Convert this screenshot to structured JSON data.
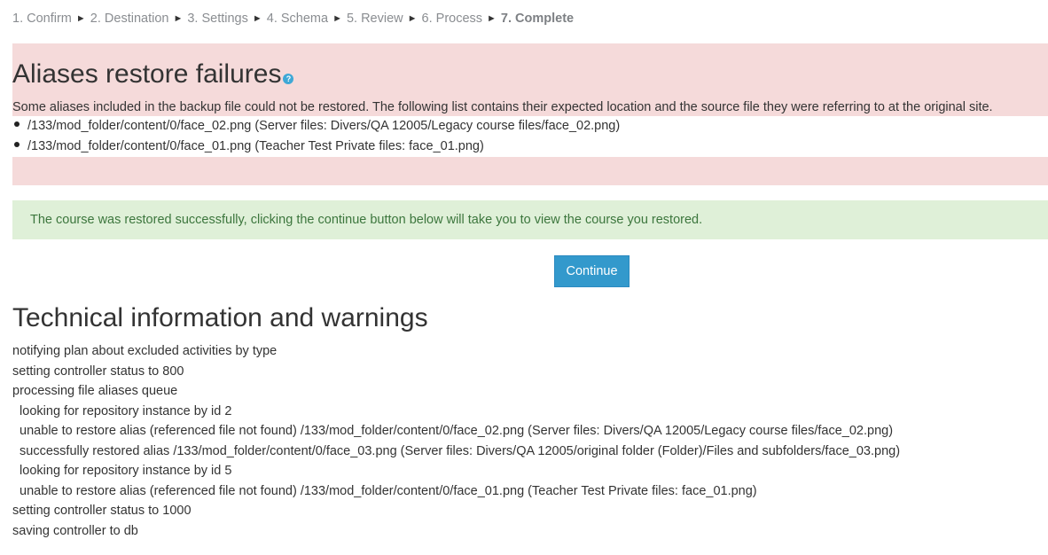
{
  "steps": [
    {
      "label": "1. Confirm"
    },
    {
      "label": "2. Destination"
    },
    {
      "label": "3. Settings"
    },
    {
      "label": "4. Schema"
    },
    {
      "label": "5. Review"
    },
    {
      "label": "6. Process"
    },
    {
      "label": "7. Complete"
    }
  ],
  "step_separator": "►",
  "error": {
    "title": "Aliases restore failures",
    "help_icon": "?",
    "description": "Some aliases included in the backup file could not be restored. The following list contains their expected location and the source file they were referring to at the original site.",
    "items": [
      "/133/mod_folder/content/0/face_02.png (Server files: Divers/QA 12005/Legacy course files/face_02.png)",
      "/133/mod_folder/content/0/face_01.png (Teacher Test Private files: face_01.png)"
    ]
  },
  "success": {
    "message": "The course was restored successfully, clicking the continue button below will take you to view the course you restored."
  },
  "continue_button": "Continue",
  "technical": {
    "title": "Technical information and warnings",
    "lines": [
      "notifying plan about excluded activities by type",
      "setting controller status to 800",
      "processing file aliases queue",
      "  looking for repository instance by id 2",
      "  unable to restore alias (referenced file not found) /133/mod_folder/content/0/face_02.png (Server files: Divers/QA 12005/Legacy course files/face_02.png)",
      "  successfully restored alias /133/mod_folder/content/0/face_03.png (Server files: Divers/QA 12005/original folder (Folder)/Files and subfolders/face_03.png)",
      "  looking for repository instance by id 5",
      "  unable to restore alias (referenced file not found) /133/mod_folder/content/0/face_01.png (Teacher Test Private files: face_01.png)",
      "setting controller status to 1000",
      "saving controller to db"
    ]
  },
  "colors": {
    "error_bg": "#f5dada",
    "success_bg": "#dff0d8",
    "success_text": "#3c763d",
    "button_bg": "#3399cc",
    "help_icon": "#3fa8d6"
  }
}
